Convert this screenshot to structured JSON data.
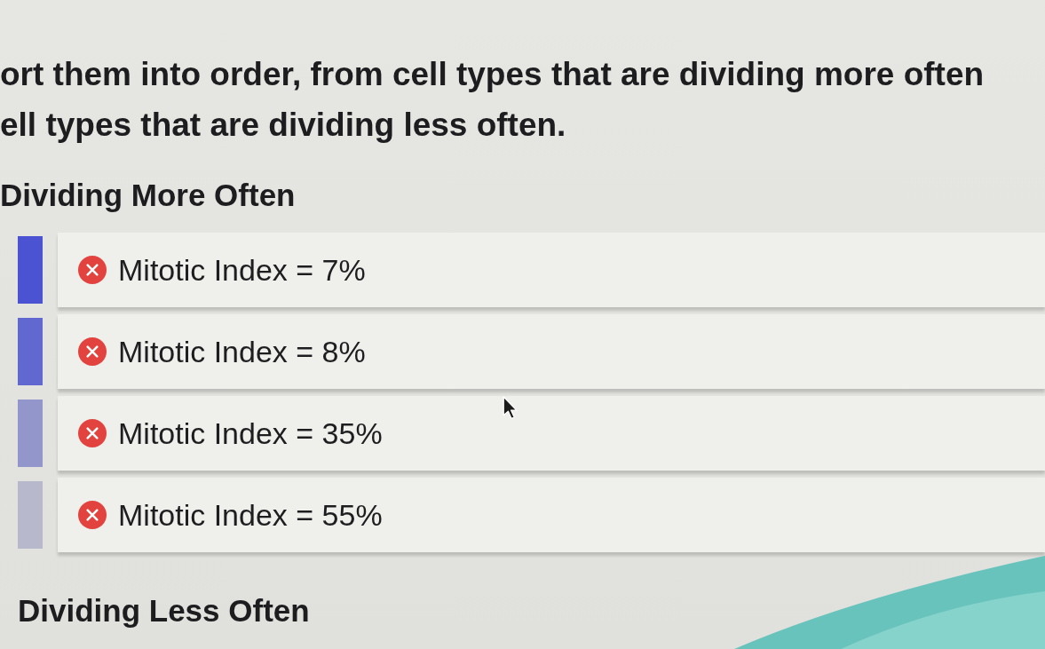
{
  "instruction": {
    "lines": [
      "ort them into order, from cell types that are dividing more often",
      "ell types that are dividing less often."
    ]
  },
  "top_label": "Dividing More Often",
  "items": [
    {
      "text": "Mitotic Index = 7%",
      "correct": false,
      "color": "#4b53d3"
    },
    {
      "text": "Mitotic Index = 8%",
      "correct": false,
      "color": "#6168cf"
    },
    {
      "text": "Mitotic Index = 35%",
      "correct": false,
      "color": "#9296cb"
    },
    {
      "text": "Mitotic Index = 55%",
      "correct": false,
      "color": "#b7b8cb"
    }
  ],
  "bottom_label": "Dividing Less Often"
}
